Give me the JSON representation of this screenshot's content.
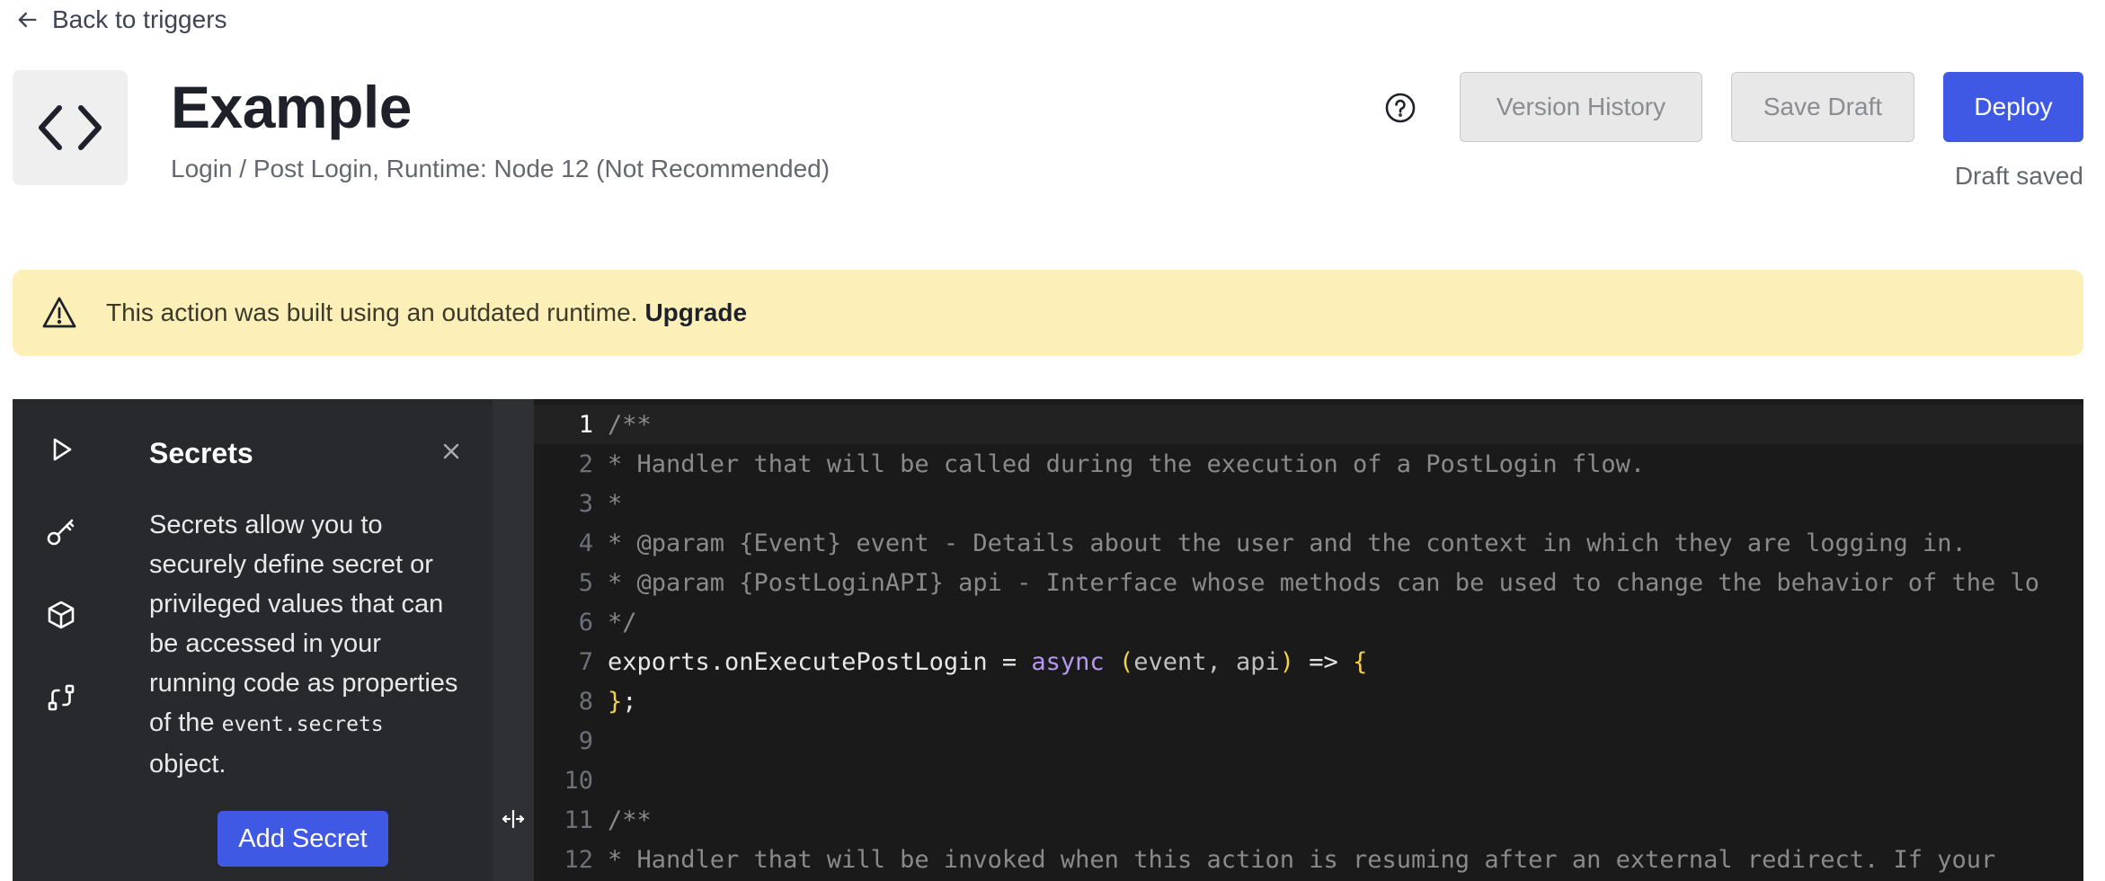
{
  "back_link": {
    "label": "Back to triggers",
    "icon": "arrow-left-icon"
  },
  "header": {
    "title": "Example",
    "subtitle": "Login / Post Login, Runtime: Node 12 (Not Recommended)",
    "action_icon": "code-brackets-icon",
    "help_icon": "question-circle-icon"
  },
  "toolbar": {
    "version_history_label": "Version History",
    "save_draft_label": "Save Draft",
    "deploy_label": "Deploy",
    "status": "Draft saved"
  },
  "banner": {
    "icon": "warning-triangle-icon",
    "message": "This action was built using an outdated runtime.",
    "link_label": "Upgrade"
  },
  "sidebar_rail": {
    "items": [
      {
        "name": "run-test",
        "icon": "play-icon"
      },
      {
        "name": "secrets",
        "icon": "key-icon"
      },
      {
        "name": "dependencies",
        "icon": "box-icon"
      },
      {
        "name": "version-control",
        "icon": "branch-icon"
      }
    ]
  },
  "secrets_panel": {
    "title": "Secrets",
    "description_before": "Secrets allow you to securely define secret or privileged values that can be accessed in your running code as properties of the",
    "description_code": "event.secrets",
    "description_after": "object.",
    "add_button_label": "Add Secret"
  },
  "editor": {
    "active_line": 1,
    "lines": [
      {
        "n": "1",
        "text": "/**"
      },
      {
        "n": "2",
        "text": "* Handler that will be called during the execution of a PostLogin flow."
      },
      {
        "n": "3",
        "text": "*"
      },
      {
        "n": "4",
        "text": "* @param {Event} event - Details about the user and the context in which they are logging in."
      },
      {
        "n": "5",
        "text": "* @param {PostLoginAPI} api - Interface whose methods can be used to change the behavior of the lo"
      },
      {
        "n": "6",
        "text": "*/"
      },
      {
        "n": "7",
        "code": [
          {
            "t": "exports.onExecutePostLogin = ",
            "k": "plain"
          },
          {
            "t": "async",
            "k": "kw"
          },
          {
            "t": " ",
            "k": "plain"
          },
          {
            "t": "(",
            "k": "paren"
          },
          {
            "t": "event, api",
            "k": "param"
          },
          {
            "t": ")",
            "k": "paren"
          },
          {
            "t": " => ",
            "k": "plain"
          },
          {
            "t": "{",
            "k": "paren"
          }
        ]
      },
      {
        "n": "8",
        "code": [
          {
            "t": "}",
            "k": "paren"
          },
          {
            "t": ";",
            "k": "plain"
          }
        ]
      },
      {
        "n": "9",
        "text": ""
      },
      {
        "n": "10",
        "text": ""
      },
      {
        "n": "11",
        "text": "/**"
      },
      {
        "n": "12",
        "text": "* Handler that will be invoked when this action is resuming after an external redirect. If your"
      }
    ]
  }
}
